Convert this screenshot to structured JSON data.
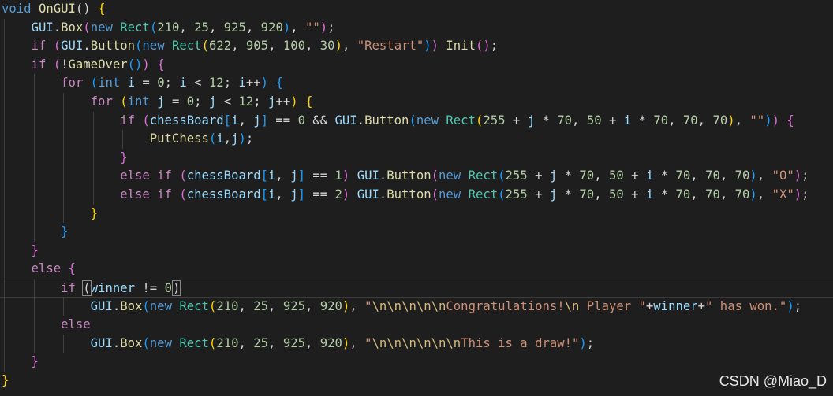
{
  "lines": [
    {
      "indent": 0,
      "tokens": [
        [
          "void ",
          "kw"
        ],
        [
          "OnGUI",
          "fn"
        ],
        [
          "() ",
          "op"
        ],
        [
          "{",
          "p1"
        ]
      ]
    },
    {
      "indent": 1,
      "tokens": [
        [
          "GUI",
          "var"
        ],
        [
          ".",
          "op"
        ],
        [
          "Box",
          "fn"
        ],
        [
          "(",
          "p2"
        ],
        [
          "new ",
          "kw"
        ],
        [
          "Rect",
          "type"
        ],
        [
          "(",
          "p3"
        ],
        [
          "210",
          "num"
        ],
        [
          ", ",
          "op"
        ],
        [
          "25",
          "num"
        ],
        [
          ", ",
          "op"
        ],
        [
          "925",
          "num"
        ],
        [
          ", ",
          "op"
        ],
        [
          "920",
          "num"
        ],
        [
          ")",
          "p3"
        ],
        [
          ", ",
          "op"
        ],
        [
          "\"\"",
          "str"
        ],
        [
          ")",
          "p2"
        ],
        [
          ";",
          "op"
        ]
      ]
    },
    {
      "indent": 1,
      "tokens": [
        [
          "if ",
          "ctl"
        ],
        [
          "(",
          "p2"
        ],
        [
          "GUI",
          "var"
        ],
        [
          ".",
          "op"
        ],
        [
          "Button",
          "fn"
        ],
        [
          "(",
          "p3"
        ],
        [
          "new ",
          "kw"
        ],
        [
          "Rect",
          "type"
        ],
        [
          "(",
          "p1"
        ],
        [
          "622",
          "num"
        ],
        [
          ", ",
          "op"
        ],
        [
          "905",
          "num"
        ],
        [
          ", ",
          "op"
        ],
        [
          "100",
          "num"
        ],
        [
          ", ",
          "op"
        ],
        [
          "30",
          "num"
        ],
        [
          ")",
          "p1"
        ],
        [
          ", ",
          "op"
        ],
        [
          "\"Restart\"",
          "str"
        ],
        [
          ")",
          "p3"
        ],
        [
          ")",
          "p2"
        ],
        [
          " ",
          "op"
        ],
        [
          "Init",
          "fn"
        ],
        [
          "()",
          "p2"
        ],
        [
          ";",
          "op"
        ]
      ]
    },
    {
      "indent": 1,
      "tokens": [
        [
          "if ",
          "ctl"
        ],
        [
          "(",
          "p2"
        ],
        [
          "!",
          "op"
        ],
        [
          "GameOver",
          "fn"
        ],
        [
          "()",
          "p3"
        ],
        [
          ") ",
          "p2"
        ],
        [
          "{",
          "p2"
        ]
      ]
    },
    {
      "indent": 2,
      "tokens": [
        [
          "for ",
          "ctl"
        ],
        [
          "(",
          "p3"
        ],
        [
          "int ",
          "kw"
        ],
        [
          "i",
          "var"
        ],
        [
          " = ",
          "op"
        ],
        [
          "0",
          "num"
        ],
        [
          "; ",
          "op"
        ],
        [
          "i",
          "var"
        ],
        [
          " < ",
          "op"
        ],
        [
          "12",
          "num"
        ],
        [
          "; ",
          "op"
        ],
        [
          "i",
          "var"
        ],
        [
          "++",
          "op"
        ],
        [
          ") ",
          "p3"
        ],
        [
          "{",
          "p3"
        ]
      ]
    },
    {
      "indent": 3,
      "tokens": [
        [
          "for ",
          "ctl"
        ],
        [
          "(",
          "p1"
        ],
        [
          "int ",
          "kw"
        ],
        [
          "j",
          "var"
        ],
        [
          " = ",
          "op"
        ],
        [
          "0",
          "num"
        ],
        [
          "; ",
          "op"
        ],
        [
          "j",
          "var"
        ],
        [
          " < ",
          "op"
        ],
        [
          "12",
          "num"
        ],
        [
          "; ",
          "op"
        ],
        [
          "j",
          "var"
        ],
        [
          "++",
          "op"
        ],
        [
          ") ",
          "p1"
        ],
        [
          "{",
          "p1"
        ]
      ]
    },
    {
      "indent": 4,
      "tokens": [
        [
          "if ",
          "ctl"
        ],
        [
          "(",
          "p2"
        ],
        [
          "chessBoard",
          "var"
        ],
        [
          "[",
          "p3"
        ],
        [
          "i",
          "var"
        ],
        [
          ", ",
          "op"
        ],
        [
          "j",
          "var"
        ],
        [
          "]",
          "p3"
        ],
        [
          " == ",
          "op"
        ],
        [
          "0",
          "num"
        ],
        [
          " && ",
          "op"
        ],
        [
          "GUI",
          "var"
        ],
        [
          ".",
          "op"
        ],
        [
          "Button",
          "fn"
        ],
        [
          "(",
          "p3"
        ],
        [
          "new ",
          "kw"
        ],
        [
          "Rect",
          "type"
        ],
        [
          "(",
          "p1"
        ],
        [
          "255",
          "num"
        ],
        [
          " + ",
          "op"
        ],
        [
          "j",
          "var"
        ],
        [
          " * ",
          "op"
        ],
        [
          "70",
          "num"
        ],
        [
          ", ",
          "op"
        ],
        [
          "50",
          "num"
        ],
        [
          " + ",
          "op"
        ],
        [
          "i",
          "var"
        ],
        [
          " * ",
          "op"
        ],
        [
          "70",
          "num"
        ],
        [
          ", ",
          "op"
        ],
        [
          "70",
          "num"
        ],
        [
          ", ",
          "op"
        ],
        [
          "70",
          "num"
        ],
        [
          ")",
          "p1"
        ],
        [
          ", ",
          "op"
        ],
        [
          "\"\"",
          "str"
        ],
        [
          ")",
          "p3"
        ],
        [
          ")",
          "p2"
        ],
        [
          " ",
          "op"
        ],
        [
          "{",
          "p2"
        ]
      ]
    },
    {
      "indent": 5,
      "tokens": [
        [
          "PutChess",
          "fn"
        ],
        [
          "(",
          "p3"
        ],
        [
          "i",
          "var"
        ],
        [
          ",",
          "op"
        ],
        [
          "j",
          "var"
        ],
        [
          ")",
          "p3"
        ],
        [
          ";",
          "op"
        ]
      ]
    },
    {
      "indent": 4,
      "tokens": [
        [
          "}",
          "p2"
        ]
      ]
    },
    {
      "indent": 4,
      "tokens": [
        [
          "else ",
          "ctl"
        ],
        [
          "if ",
          "ctl"
        ],
        [
          "(",
          "p2"
        ],
        [
          "chessBoard",
          "var"
        ],
        [
          "[",
          "p3"
        ],
        [
          "i",
          "var"
        ],
        [
          ", ",
          "op"
        ],
        [
          "j",
          "var"
        ],
        [
          "]",
          "p3"
        ],
        [
          " == ",
          "op"
        ],
        [
          "1",
          "num"
        ],
        [
          ") ",
          "p2"
        ],
        [
          "GUI",
          "var"
        ],
        [
          ".",
          "op"
        ],
        [
          "Button",
          "fn"
        ],
        [
          "(",
          "p2"
        ],
        [
          "new ",
          "kw"
        ],
        [
          "Rect",
          "type"
        ],
        [
          "(",
          "p3"
        ],
        [
          "255",
          "num"
        ],
        [
          " + ",
          "op"
        ],
        [
          "j",
          "var"
        ],
        [
          " * ",
          "op"
        ],
        [
          "70",
          "num"
        ],
        [
          ", ",
          "op"
        ],
        [
          "50",
          "num"
        ],
        [
          " + ",
          "op"
        ],
        [
          "i",
          "var"
        ],
        [
          " * ",
          "op"
        ],
        [
          "70",
          "num"
        ],
        [
          ", ",
          "op"
        ],
        [
          "70",
          "num"
        ],
        [
          ", ",
          "op"
        ],
        [
          "70",
          "num"
        ],
        [
          ")",
          "p3"
        ],
        [
          ", ",
          "op"
        ],
        [
          "\"O\"",
          "str"
        ],
        [
          ")",
          "p2"
        ],
        [
          ";",
          "op"
        ]
      ]
    },
    {
      "indent": 4,
      "tokens": [
        [
          "else ",
          "ctl"
        ],
        [
          "if ",
          "ctl"
        ],
        [
          "(",
          "p2"
        ],
        [
          "chessBoard",
          "var"
        ],
        [
          "[",
          "p3"
        ],
        [
          "i",
          "var"
        ],
        [
          ", ",
          "op"
        ],
        [
          "j",
          "var"
        ],
        [
          "]",
          "p3"
        ],
        [
          " == ",
          "op"
        ],
        [
          "2",
          "num"
        ],
        [
          ") ",
          "p2"
        ],
        [
          "GUI",
          "var"
        ],
        [
          ".",
          "op"
        ],
        [
          "Button",
          "fn"
        ],
        [
          "(",
          "p2"
        ],
        [
          "new ",
          "kw"
        ],
        [
          "Rect",
          "type"
        ],
        [
          "(",
          "p3"
        ],
        [
          "255",
          "num"
        ],
        [
          " + ",
          "op"
        ],
        [
          "j",
          "var"
        ],
        [
          " * ",
          "op"
        ],
        [
          "70",
          "num"
        ],
        [
          ", ",
          "op"
        ],
        [
          "50",
          "num"
        ],
        [
          " + ",
          "op"
        ],
        [
          "i",
          "var"
        ],
        [
          " * ",
          "op"
        ],
        [
          "70",
          "num"
        ],
        [
          ", ",
          "op"
        ],
        [
          "70",
          "num"
        ],
        [
          ", ",
          "op"
        ],
        [
          "70",
          "num"
        ],
        [
          ")",
          "p3"
        ],
        [
          ", ",
          "op"
        ],
        [
          "\"X\"",
          "str"
        ],
        [
          ")",
          "p2"
        ],
        [
          ";",
          "op"
        ]
      ]
    },
    {
      "indent": 3,
      "tokens": [
        [
          "}",
          "p1"
        ]
      ]
    },
    {
      "indent": 2,
      "tokens": [
        [
          "}",
          "p3"
        ]
      ]
    },
    {
      "indent": 1,
      "tokens": [
        [
          "}",
          "p2"
        ]
      ]
    },
    {
      "indent": 1,
      "tokens": [
        [
          "else ",
          "ctl"
        ],
        [
          "{",
          "p2"
        ]
      ]
    },
    {
      "indent": 2,
      "current": true,
      "tokens": [
        [
          "if ",
          "ctl"
        ],
        [
          "(",
          "bm"
        ],
        [
          "winner",
          "var"
        ],
        [
          " != ",
          "op"
        ],
        [
          "0",
          "num"
        ],
        [
          "|",
          "cursor"
        ],
        [
          ")",
          "bm"
        ]
      ]
    },
    {
      "indent": 3,
      "tokens": [
        [
          "GUI",
          "var"
        ],
        [
          ".",
          "op"
        ],
        [
          "Box",
          "fn"
        ],
        [
          "(",
          "p3"
        ],
        [
          "new ",
          "kw"
        ],
        [
          "Rect",
          "type"
        ],
        [
          "(",
          "p1"
        ],
        [
          "210",
          "num"
        ],
        [
          ", ",
          "op"
        ],
        [
          "25",
          "num"
        ],
        [
          ", ",
          "op"
        ],
        [
          "925",
          "num"
        ],
        [
          ", ",
          "op"
        ],
        [
          "920",
          "num"
        ],
        [
          ")",
          "p1"
        ],
        [
          ", ",
          "op"
        ],
        [
          "\"",
          "str"
        ],
        [
          "\\n\\n\\n\\n\\n",
          "esc"
        ],
        [
          "Congratulations!",
          "str"
        ],
        [
          "\\n",
          "esc"
        ],
        [
          " Player \"",
          "str"
        ],
        [
          "+",
          "op"
        ],
        [
          "winner",
          "var"
        ],
        [
          "+",
          "op"
        ],
        [
          "\" has won.\"",
          "str"
        ],
        [
          ")",
          "p3"
        ],
        [
          ";",
          "op"
        ]
      ]
    },
    {
      "indent": 2,
      "tokens": [
        [
          "else",
          "ctl"
        ]
      ]
    },
    {
      "indent": 3,
      "tokens": [
        [
          "GUI",
          "var"
        ],
        [
          ".",
          "op"
        ],
        [
          "Box",
          "fn"
        ],
        [
          "(",
          "p3"
        ],
        [
          "new ",
          "kw"
        ],
        [
          "Rect",
          "type"
        ],
        [
          "(",
          "p1"
        ],
        [
          "210",
          "num"
        ],
        [
          ", ",
          "op"
        ],
        [
          "25",
          "num"
        ],
        [
          ", ",
          "op"
        ],
        [
          "925",
          "num"
        ],
        [
          ", ",
          "op"
        ],
        [
          "920",
          "num"
        ],
        [
          ")",
          "p1"
        ],
        [
          ", ",
          "op"
        ],
        [
          "\"",
          "str"
        ],
        [
          "\\n\\n\\n\\n\\n\\n",
          "esc"
        ],
        [
          "This is a draw!\"",
          "str"
        ],
        [
          ")",
          "p3"
        ],
        [
          ";",
          "op"
        ]
      ]
    },
    {
      "indent": 1,
      "tokens": [
        [
          "}",
          "p2"
        ]
      ]
    },
    {
      "indent": 0,
      "tokens": [
        [
          "}",
          "p1"
        ]
      ]
    }
  ],
  "watermark": "CSDN @Miao_D",
  "colors": {
    "background": "#1e1e1e",
    "keyword": "#569cd6",
    "control": "#c586c0",
    "type": "#4ec9b0",
    "function": "#dcdcaa",
    "variable": "#9cdcfe",
    "number": "#b5cea8",
    "string": "#ce9178"
  }
}
